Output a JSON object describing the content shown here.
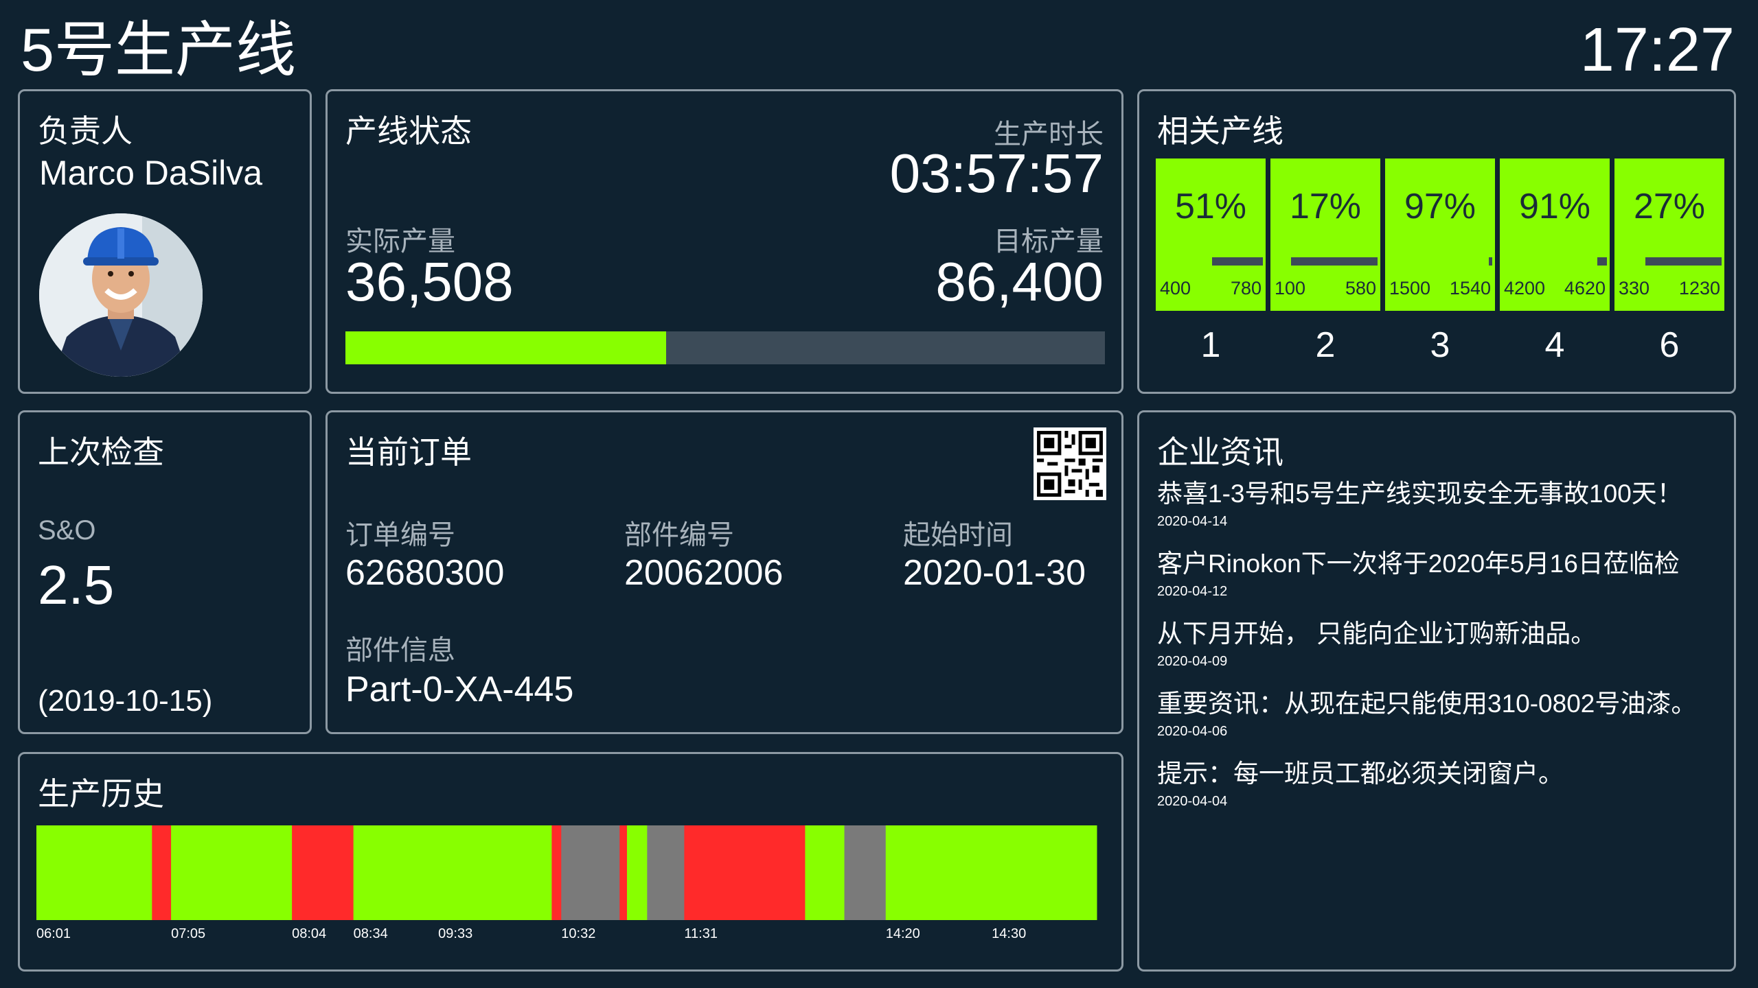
{
  "header": {
    "title": "5号生产线",
    "clock": "17:27"
  },
  "owner": {
    "heading": "负责人",
    "name": "Marco DaSilva"
  },
  "status": {
    "heading": "产线状态",
    "duration_label": "生产时长",
    "duration": "03:57:57",
    "actual_label": "实际产量",
    "actual": "36,508",
    "target_label": "目标产量",
    "target": "86,400",
    "progress": 0.4226
  },
  "related": {
    "heading": "相关产线",
    "lines": [
      {
        "pct": "51%",
        "progress": 0.51,
        "low": "400",
        "high": "780",
        "id": "1"
      },
      {
        "pct": "17%",
        "progress": 0.17,
        "low": "100",
        "high": "580",
        "id": "2"
      },
      {
        "pct": "97%",
        "progress": 0.97,
        "low": "1500",
        "high": "1540",
        "id": "3"
      },
      {
        "pct": "91%",
        "progress": 0.91,
        "low": "4200",
        "high": "4620",
        "id": "4"
      },
      {
        "pct": "27%",
        "progress": 0.27,
        "low": "330",
        "high": "1230",
        "id": "6"
      }
    ]
  },
  "check": {
    "heading": "上次检查",
    "metric_label": "S&O",
    "metric_value": "2.5",
    "date": "(2019-10-15)"
  },
  "order": {
    "heading": "当前订单",
    "order_no_label": "订单编号",
    "order_no": "62680300",
    "part_no_label": "部件编号",
    "part_no": "20062006",
    "start_label": "起始时间",
    "start": "2020-01-30",
    "part_info_label": "部件信息",
    "part_info": "Part-0-XA-445"
  },
  "news": {
    "heading": "企业资讯",
    "items": [
      {
        "text": "恭喜1-3号和5号生产线实现安全无事故100天！",
        "date": "2020-04-14"
      },
      {
        "text": "客户Rinokon下一次将于2020年5月16日莅临检",
        "date": "2020-04-12"
      },
      {
        "text": "从下月开始， 只能向企业订购新油品。",
        "date": "2020-04-09"
      },
      {
        "text": "重要资讯：从现在起只能使用310-0802号油漆。",
        "date": "2020-04-06"
      },
      {
        "text": "提示：每一班员工都必须关闭窗户。",
        "date": "2020-04-04"
      }
    ]
  },
  "history": {
    "heading": "生产历史",
    "colors": {
      "run": "#88ff00",
      "stop": "#ff2a2a",
      "idle": "#7a7a7a"
    },
    "ticks": [
      "06:01",
      "07:05",
      "08:04",
      "08:34",
      "09:33",
      "10:32",
      "11:31",
      "14:20",
      "14:30"
    ],
    "segments": [
      {
        "state": "run",
        "start": 0.0,
        "end": 0.109
      },
      {
        "state": "stop",
        "start": 0.109,
        "end": 0.127
      },
      {
        "state": "run",
        "start": 0.127,
        "end": 0.241
      },
      {
        "state": "stop",
        "start": 0.241,
        "end": 0.299
      },
      {
        "state": "run",
        "start": 0.299,
        "end": 0.486
      },
      {
        "state": "stop",
        "start": 0.486,
        "end": 0.495
      },
      {
        "state": "idle",
        "start": 0.495,
        "end": 0.55
      },
      {
        "state": "stop",
        "start": 0.55,
        "end": 0.557
      },
      {
        "state": "run",
        "start": 0.557,
        "end": 0.576
      },
      {
        "state": "idle",
        "start": 0.576,
        "end": 0.611
      },
      {
        "state": "stop",
        "start": 0.611,
        "end": 0.725
      },
      {
        "state": "run",
        "start": 0.725,
        "end": 0.762
      },
      {
        "state": "idle",
        "start": 0.762,
        "end": 0.801
      },
      {
        "state": "run",
        "start": 0.801,
        "end": 1.0
      }
    ],
    "tick_positions": [
      0.0,
      0.127,
      0.241,
      0.299,
      0.379,
      0.495,
      0.611,
      0.801,
      0.901
    ]
  }
}
